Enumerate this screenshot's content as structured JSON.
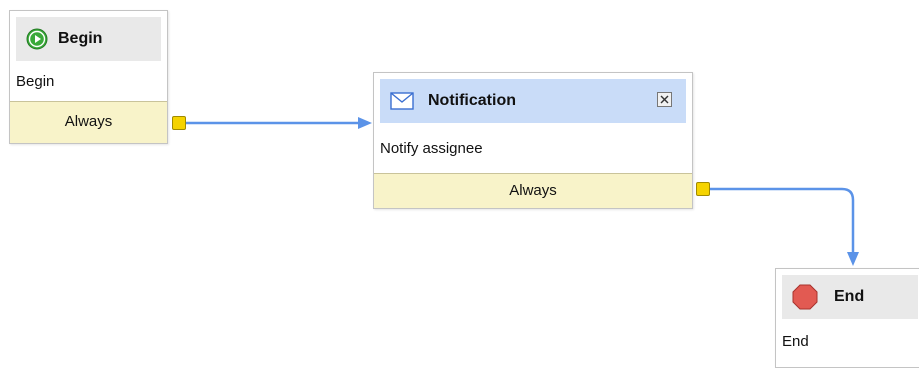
{
  "nodes": {
    "begin": {
      "title": "Begin",
      "body": "Begin",
      "footer": "Always"
    },
    "notification": {
      "title": "Notification",
      "body": "Notify assignee",
      "footer": "Always"
    },
    "end": {
      "title": "End",
      "body": "End"
    }
  },
  "colors": {
    "connector": "#5b93e8",
    "port": "#f5d300",
    "footer_bg": "#f8f3c9",
    "header_gray": "#e9e9e9",
    "header_blue": "#c9dcf8"
  },
  "icons": {
    "begin": "play-icon",
    "notification": "envelope-icon",
    "close": "close-icon",
    "end": "stop-icon"
  }
}
